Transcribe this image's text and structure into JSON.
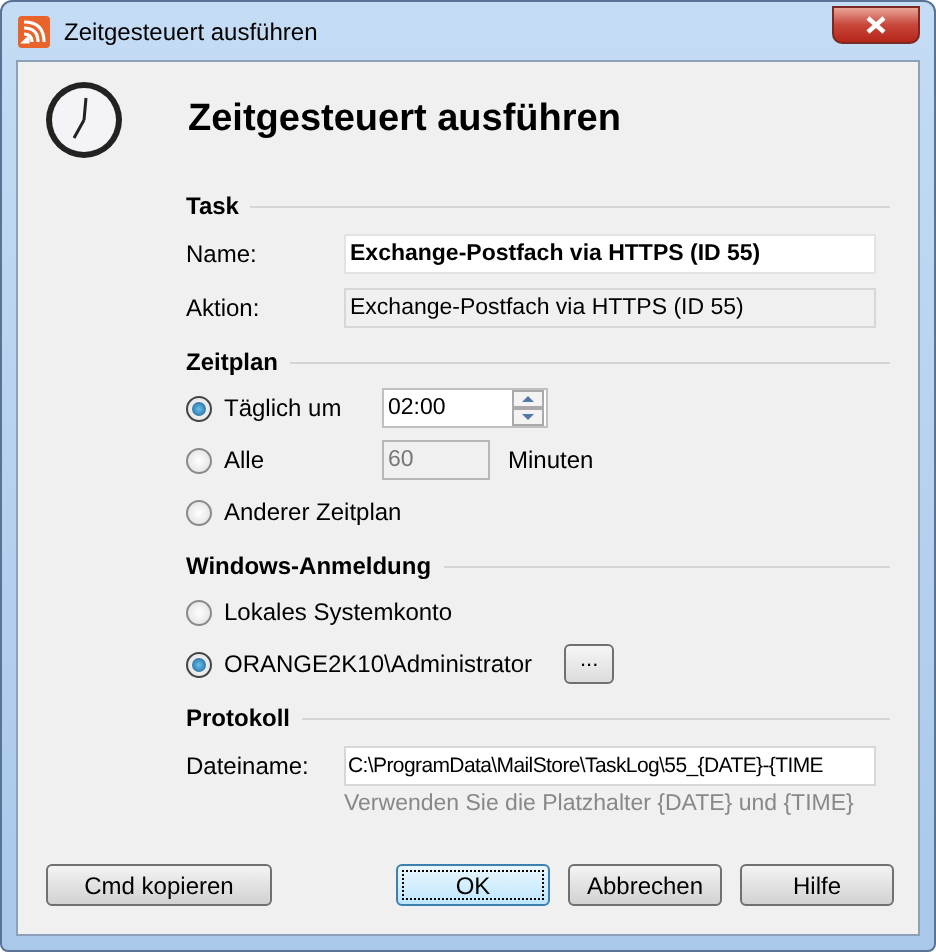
{
  "window": {
    "title": "Zeitgesteuert ausführen"
  },
  "heading": "Zeitgesteuert ausführen",
  "task": {
    "title": "Task",
    "name_label": "Name:",
    "name_value": "Exchange-Postfach via HTTPS (ID 55)",
    "action_label": "Aktion:",
    "action_value": "Exchange-Postfach via HTTPS (ID 55)"
  },
  "schedule": {
    "title": "Zeitplan",
    "options": [
      {
        "kind": "time",
        "label": "Täglich um",
        "selected": true,
        "value": "02:00",
        "disabled": false
      },
      {
        "kind": "interval",
        "label": "Alle",
        "selected": false,
        "value": "60",
        "disabled": true,
        "unit": "Minuten"
      },
      {
        "kind": "plain",
        "label": "Anderer Zeitplan",
        "selected": false
      }
    ]
  },
  "login": {
    "title": "Windows-Anmeldung",
    "options": [
      {
        "kind": "plain",
        "label": "Lokales Systemkonto",
        "selected": false
      },
      {
        "kind": "browse",
        "label": "ORANGE2K10\\Administrator",
        "selected": true,
        "button": "..."
      }
    ]
  },
  "protocol": {
    "title": "Protokoll",
    "filename_label": "Dateiname:",
    "filename_value": "C:\\ProgramData\\MailStore\\TaskLog\\55_{DATE}-{TIME",
    "hint": "Verwenden Sie die Platzhalter {DATE} und {TIME}"
  },
  "buttons": [
    {
      "label": "Cmd kopieren",
      "focused": false
    },
    {
      "label": "OK",
      "focused": true
    },
    {
      "label": "Abbrechen",
      "focused": false
    },
    {
      "label": "Hilfe",
      "focused": false
    }
  ]
}
